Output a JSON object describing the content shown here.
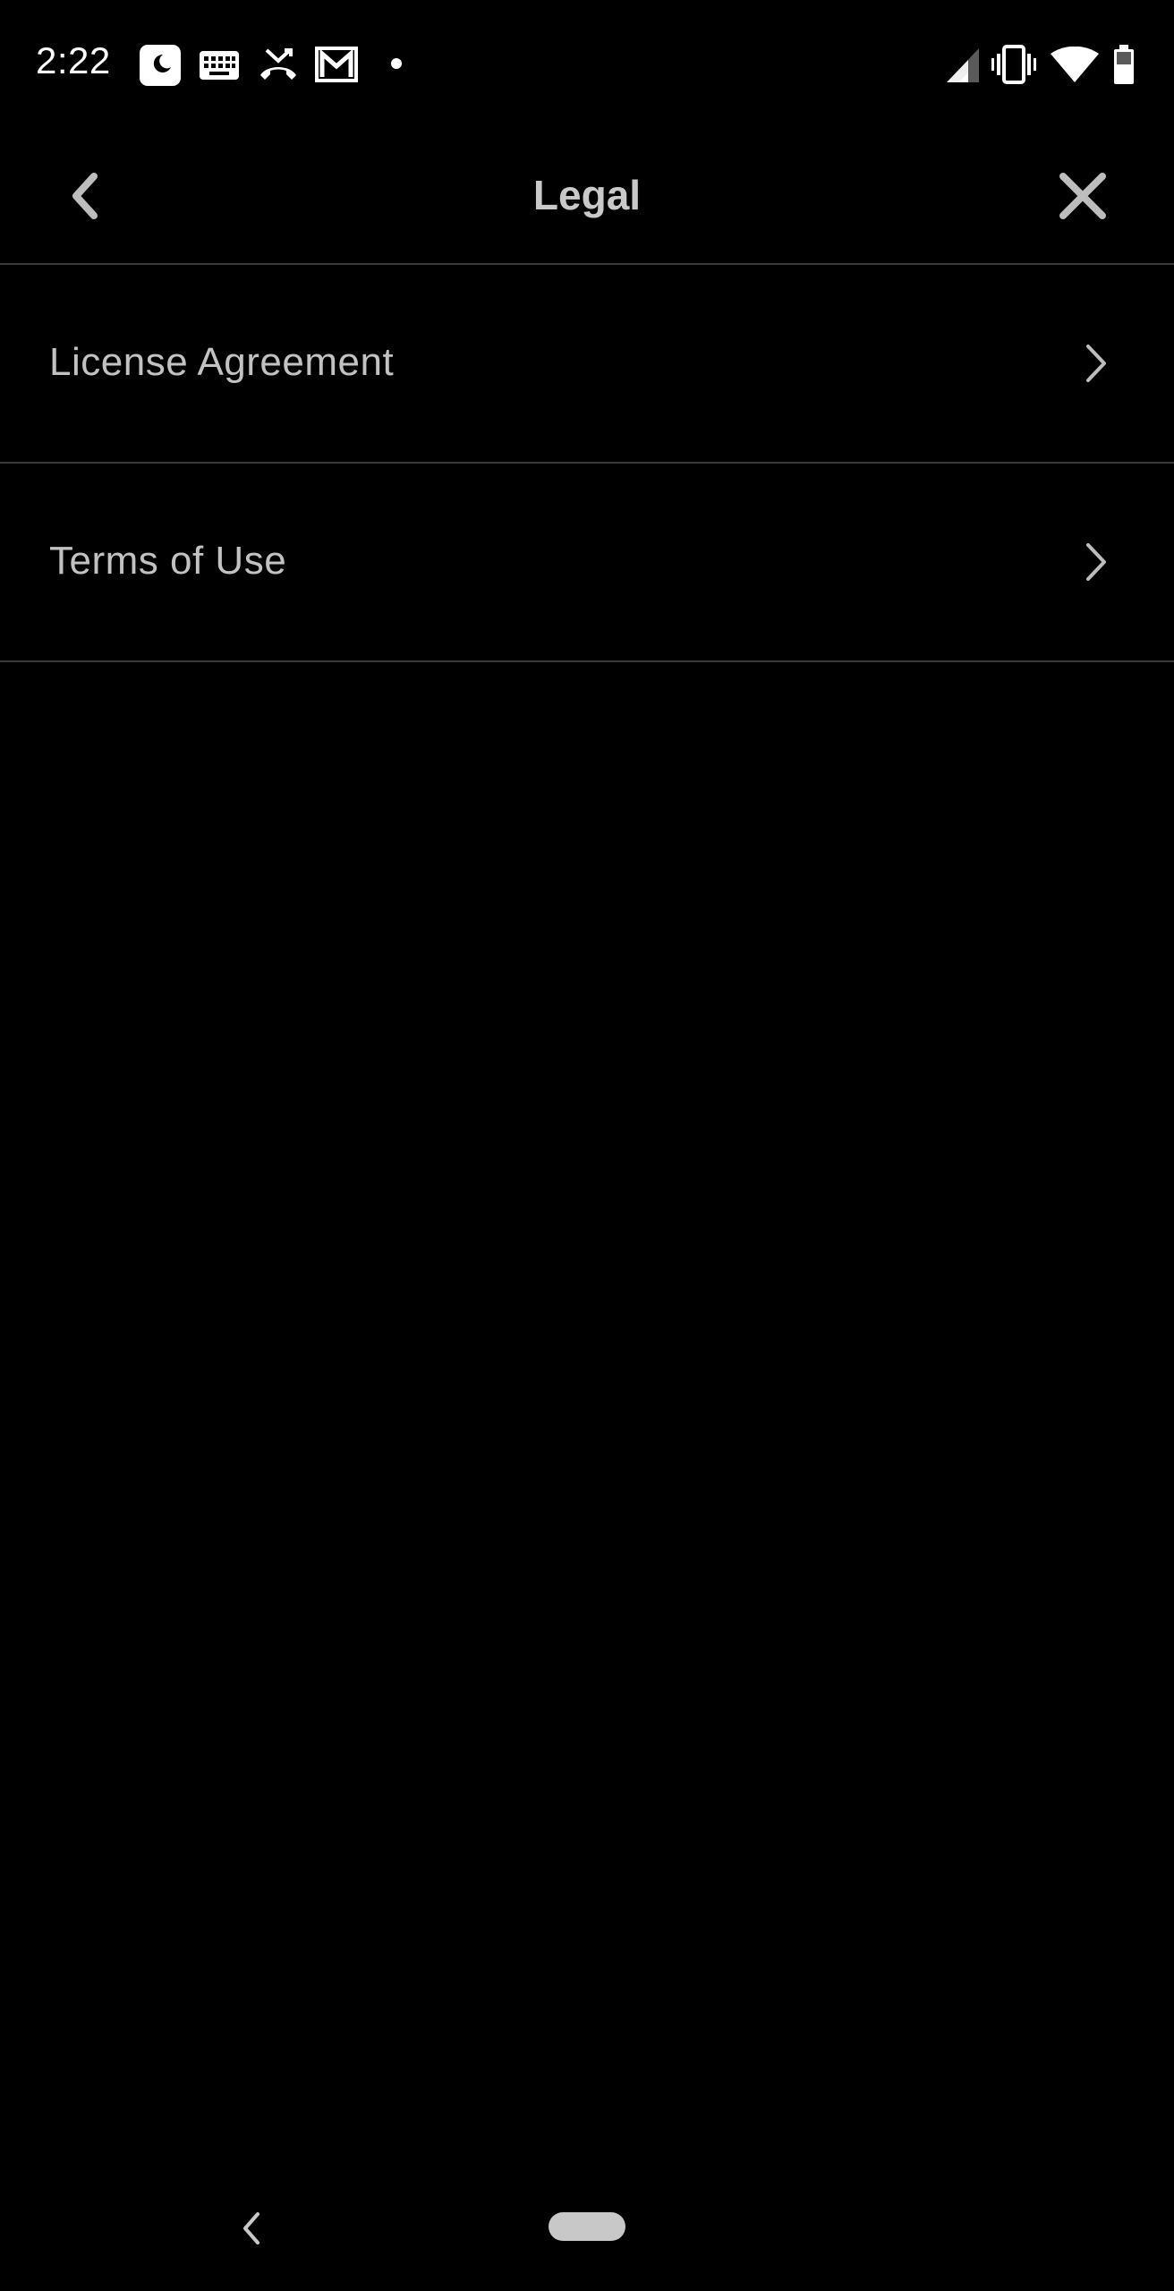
{
  "status_bar": {
    "time": "2:22",
    "left_icons": [
      "do-not-disturb-app-icon",
      "keyboard-icon",
      "missed-call-icon",
      "gmail-icon",
      "notification-dot-icon"
    ],
    "right_icons": [
      "cellular-signal-icon",
      "vibrate-icon",
      "wifi-icon",
      "battery-icon"
    ]
  },
  "app_bar": {
    "title": "Legal",
    "back_icon": "chevron-left-icon",
    "close_icon": "close-icon"
  },
  "menu": {
    "items": [
      {
        "label": "License Agreement",
        "icon": "chevron-right-icon"
      },
      {
        "label": "Terms of Use",
        "icon": "chevron-right-icon"
      }
    ]
  },
  "nav_bar": {
    "back_icon": "nav-back-icon",
    "home_icon": "nav-home-pill-icon"
  },
  "colors": {
    "background": "#000000",
    "title_text": "#c9c9c9",
    "item_text": "#c2c2c2",
    "divider": "#3a3a3a",
    "icon": "#bdbdbd"
  }
}
